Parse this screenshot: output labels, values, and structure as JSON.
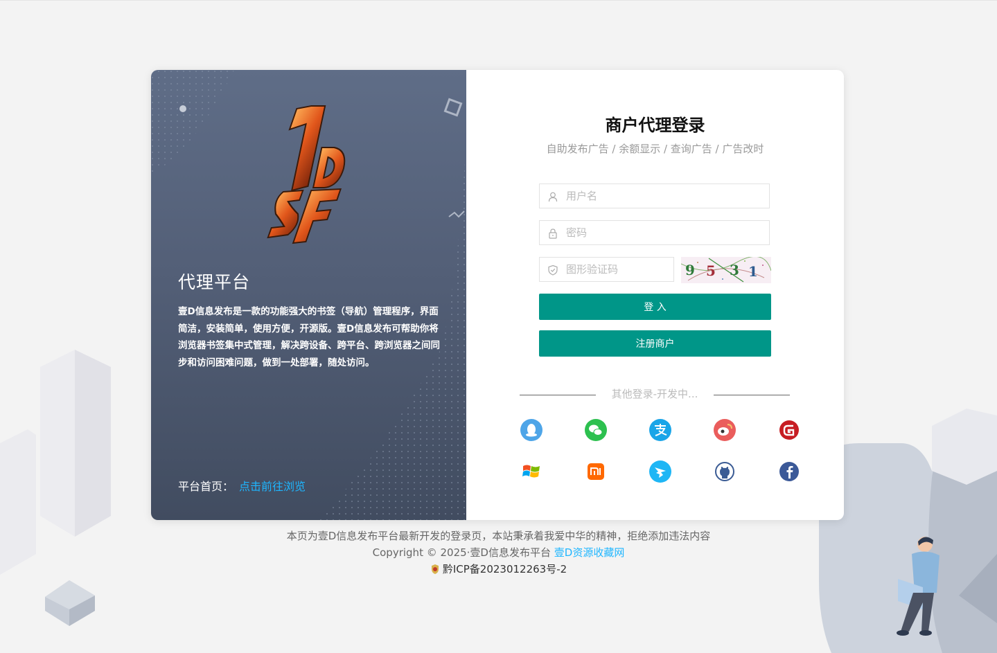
{
  "left": {
    "logo_alt": "1DSF",
    "title": "代理平台",
    "description": "壹D信息发布是一款的功能强大的书签（导航）管理程序，界面简洁，安装简单，使用方便，开源版。壹D信息发布可帮助你将浏览器书签集中式管理，解决跨设备、跨平台、跨浏览器之间同步和访问困难问题，做到一处部署，随处访问。",
    "home_label": "平台首页：",
    "home_link": "点击前往浏览"
  },
  "login": {
    "title": "商户代理登录",
    "subtitle": "自助发布广告 / 余额显示 / 查询广告 / 广告改时",
    "username_placeholder": "用户名",
    "password_placeholder": "密码",
    "captcha_placeholder": "图形验证码",
    "captcha_digits": [
      "9",
      "5",
      "3",
      "1"
    ],
    "login_button": "登 入",
    "register_button": "注册商户",
    "other_login": "其他登录-开发中..."
  },
  "social": [
    {
      "name": "qq",
      "color": "#4ea5e8"
    },
    {
      "name": "wechat",
      "color": "#2dc04f"
    },
    {
      "name": "alipay",
      "color": "#1aa5e8"
    },
    {
      "name": "weibo",
      "color": "#ea5d5c"
    },
    {
      "name": "gitee",
      "color": "#c71d23"
    },
    {
      "name": "windows",
      "color": "#f25022"
    },
    {
      "name": "xiaomi",
      "color": "#ff6900"
    },
    {
      "name": "dingtalk",
      "color": "#1eb6f5"
    },
    {
      "name": "github",
      "color": "#3a5b94"
    },
    {
      "name": "facebook",
      "color": "#3b5998"
    }
  ],
  "footer": {
    "notice": "本页为壹D信息发布平台最新开发的登录页，本站秉承着我爱中华的精神，拒绝添加违法内容",
    "copyright": "Copyright © 2025·壹D信息发布平台",
    "copyright_link": "壹D资源收藏网",
    "icp": "黔ICP备2023012263号-2"
  },
  "colors": {
    "primary": "#009688",
    "link": "#1eb6ff",
    "panel": "#535f77"
  }
}
